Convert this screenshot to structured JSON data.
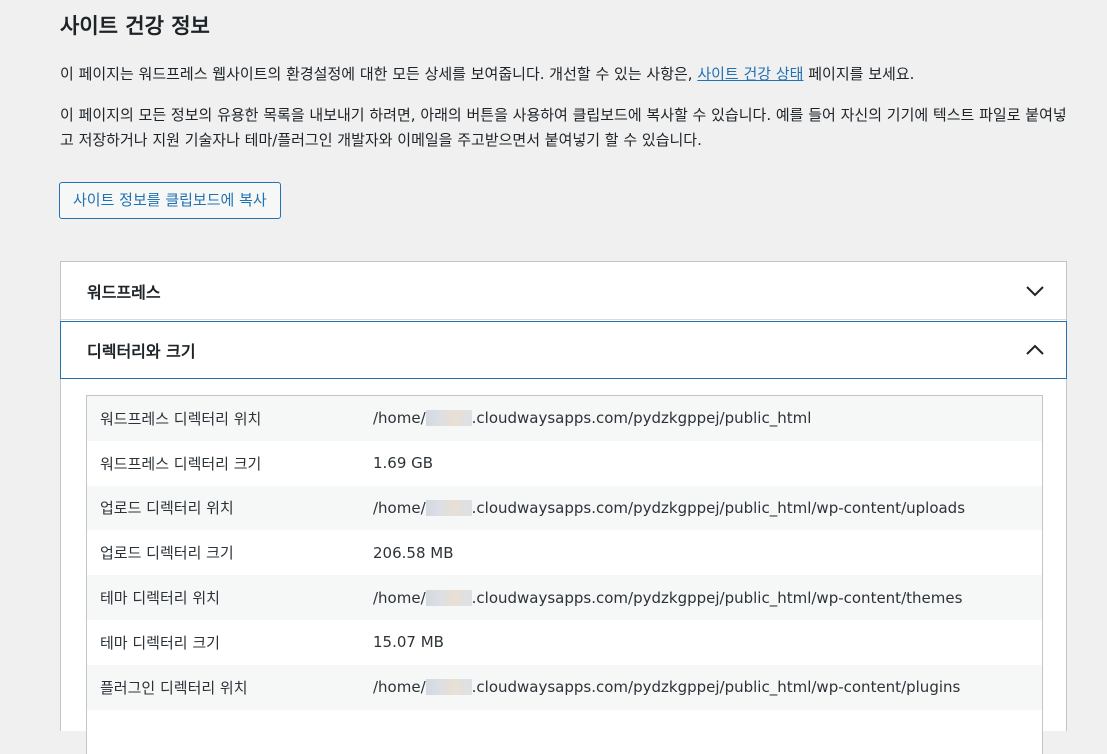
{
  "page": {
    "title": "사이트 건강 정보",
    "intro_text": "이 페이지는 워드프레스 웹사이트의 환경설정에 대한 모든 상세를 보여줍니다. 개선할 수 있는 사항은, ",
    "intro_link": "사이트 건강 상태",
    "intro_suffix": " 페이지를 보세요.",
    "export_text": "이 페이지의 모든 정보의 유용한 목록을 내보내기 하려면, 아래의 버튼을 사용하여 클립보드에 복사할 수 있습니다. 예를 들어 자신의 기기에 텍스트 파일로 붙여넣고 저장하거나 지원 기술자나 테마/플러그인 개발자와 이메일을 주고받으면서 붙여넣기 할 수 있습니다.",
    "copy_button": "사이트 정보를 클립보드에 복사"
  },
  "accordion": [
    {
      "label": "워드프레스",
      "expanded": false,
      "icon": "chevron-down-icon"
    },
    {
      "label": "디렉터리와 크기",
      "expanded": true,
      "icon": "chevron-up-icon"
    }
  ],
  "directory_table": {
    "rows": [
      {
        "key": "워드프레스 디렉터리 위치",
        "value_prefix": "/home/",
        "value_suffix": ".cloudwaysapps.com/pydzkgppej/public_html",
        "redacted": true
      },
      {
        "key": "워드프레스 디렉터리 크기",
        "value_prefix": "1.69 GB",
        "value_suffix": "",
        "redacted": false
      },
      {
        "key": "업로드 디렉터리 위치",
        "value_prefix": "/home/",
        "value_suffix": ".cloudwaysapps.com/pydzkgppej/public_html/wp-content/uploads",
        "redacted": true
      },
      {
        "key": "업로드 디렉터리 크기",
        "value_prefix": "206.58 MB",
        "value_suffix": "",
        "redacted": false
      },
      {
        "key": "테마 디렉터리 위치",
        "value_prefix": "/home/",
        "value_suffix": ".cloudwaysapps.com/pydzkgppej/public_html/wp-content/themes",
        "redacted": true
      },
      {
        "key": "테마 디렉터리 크기",
        "value_prefix": "15.07 MB",
        "value_suffix": "",
        "redacted": false
      },
      {
        "key": "플러그인 디렉터리 위치",
        "value_prefix": "/home/",
        "value_suffix": ".cloudwaysapps.com/pydzkgppej/public_html/wp-content/plugins",
        "redacted": true
      }
    ]
  },
  "colors": {
    "background": "#f0f0f1",
    "accent": "#2271b1",
    "text": "#1d2327",
    "row_alt": "#f6f7f7"
  }
}
